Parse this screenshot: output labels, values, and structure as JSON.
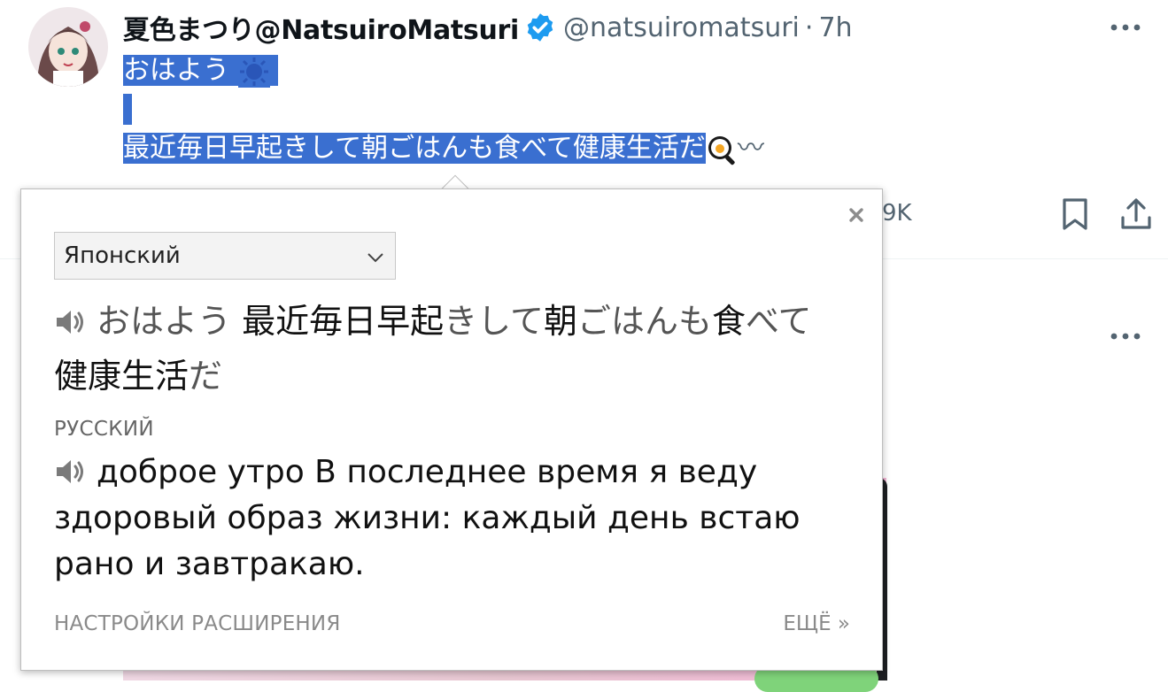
{
  "tweet": {
    "display_name": "夏色まつり@NatsuiroMatsuri",
    "handle": "@natsuiromatsuri",
    "separator": "·",
    "time": "7h",
    "text_line1": "おはよう",
    "text_line3": "最近毎日早起きして朝ごはんも食べて健康生活だ",
    "text_trailing": "〰",
    "stat_partial": "9K"
  },
  "popup": {
    "source_language": "Японский",
    "source_text_parts": [
      {
        "t": "おはよう ",
        "k": false
      },
      {
        "t": "最近毎日早起",
        "k": true
      },
      {
        "t": "きして",
        "k": false
      },
      {
        "t": "朝",
        "k": true
      },
      {
        "t": "ごはんも",
        "k": false
      },
      {
        "t": "食",
        "k": true
      },
      {
        "t": "べて",
        "k": false
      },
      {
        "t": "健康生活",
        "k": true
      },
      {
        "t": "だ",
        "k": false
      }
    ],
    "target_language_label": "РУССКИЙ",
    "translation": "доброе утро В последнее время я веду здоровый образ жизни: каждый день встаю рано и завтракаю.",
    "settings_link": "НАСТРОЙКИ РАСШИРЕНИЯ",
    "more_link": "ЕЩЁ »"
  },
  "icons": {
    "verified": "verified-badge-icon",
    "more": "more-horizontal-icon",
    "bookmark": "bookmark-icon",
    "share": "share-icon",
    "close": "close-icon",
    "speaker": "speaker-icon",
    "chevron": "chevron-down-icon",
    "sun": "sun-emoji",
    "egg": "fried-egg-emoji"
  },
  "colors": {
    "selection": "#3a6fd0",
    "verified": "#1d9bf0",
    "muted": "#536471"
  }
}
